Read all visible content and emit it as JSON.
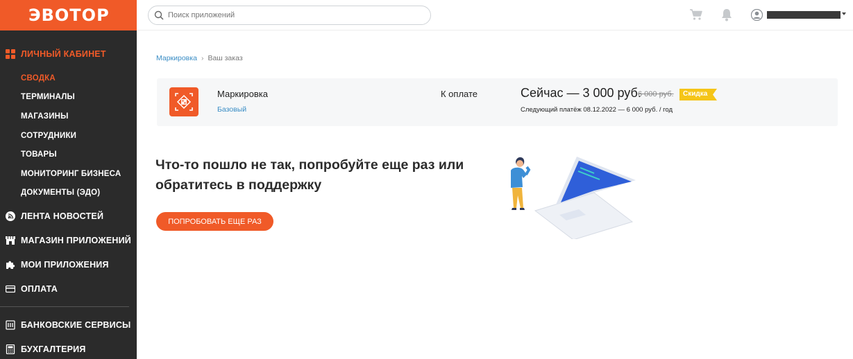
{
  "sidebar": {
    "logo": "ЭВОТОР",
    "main_section": "ЛИЧНЫЙ КАБИНЕТ",
    "sub_items": [
      "СВОДКА",
      "ТЕРМИНАЛЫ",
      "МАГАЗИНЫ",
      "СОТРУДНИКИ",
      "ТОВАРЫ",
      "МОНИТОРИНГ БИЗНЕСА",
      "ДОКУМЕНТЫ (ЭДО)"
    ],
    "active_sub_item": "СВОДКА",
    "sections": [
      "ЛЕНТА НОВОСТЕЙ",
      "МАГАЗИН ПРИЛОЖЕНИЙ",
      "МОИ ПРИЛОЖЕНИЯ",
      "ОПЛАТА"
    ],
    "bottom_sections": [
      "БАНКОВСКИЕ СЕРВИСЫ",
      "БУХГАЛТЕРИЯ"
    ],
    "accent_color": "#f05a28",
    "background_color": "#2b2b2b"
  },
  "header": {
    "search_placeholder": "Поиск приложений",
    "icons": [
      "cart-icon",
      "bell-icon",
      "user-icon"
    ]
  },
  "breadcrumb": {
    "link": "Маркировка",
    "separator": "›",
    "current": "Ваш заказ"
  },
  "order": {
    "app_name": "Маркировка",
    "plan": "Базовый",
    "pay_label": "К оплате",
    "price_now": "Сейчас — 3 000 руб.",
    "price_old": "6 000 руб.",
    "discount_badge": "Скидка",
    "next_payment": "Следующий платёж 08.12.2022 — 6 000 руб. / год"
  },
  "error": {
    "title": "Что-то пошло не так, попробуйте еще раз или обратитесь в поддержку",
    "retry_button": "Попробовать еще раз"
  },
  "colors": {
    "link": "#3a8dc5",
    "badge": "#f5c518",
    "laptop_screen": "#2f5fd9"
  }
}
